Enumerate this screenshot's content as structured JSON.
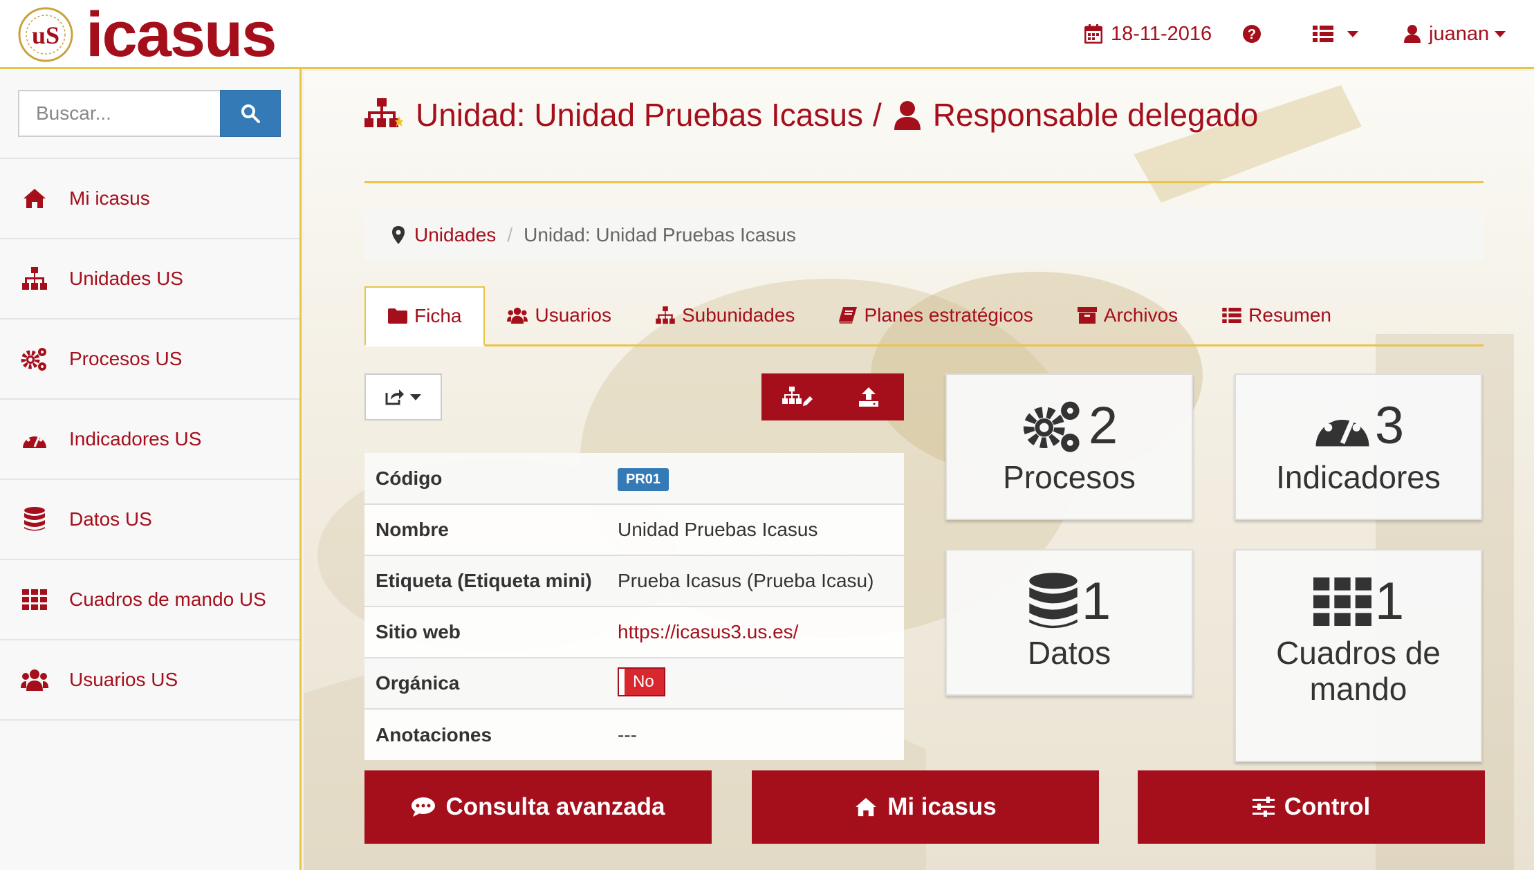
{
  "brand": {
    "name": "icasus"
  },
  "navbar": {
    "date": "18-11-2016",
    "user": "juanan",
    "icons": {
      "date": "calendar-icon",
      "help": "question-circle-icon",
      "menu": "list-icon",
      "user": "user-icon"
    }
  },
  "search": {
    "placeholder": "Buscar..."
  },
  "sidebar": {
    "items": [
      {
        "label": "Mi icasus",
        "icon": "home-icon"
      },
      {
        "label": "Unidades US",
        "icon": "sitemap-icon"
      },
      {
        "label": "Procesos US",
        "icon": "cogs-icon"
      },
      {
        "label": "Indicadores US",
        "icon": "dashboard-icon"
      },
      {
        "label": "Datos US",
        "icon": "database-icon"
      },
      {
        "label": "Cuadros de mando US",
        "icon": "th-icon"
      },
      {
        "label": "Usuarios US",
        "icon": "users-icon"
      }
    ]
  },
  "page": {
    "title_unit": "Unidad: Unidad Pruebas Icasus",
    "title_sep": "/",
    "title_role": "Responsable delegado"
  },
  "breadcrumb": {
    "link": "Unidades",
    "separator": "/",
    "current": "Unidad: Unidad Pruebas Icasus"
  },
  "tabs": [
    {
      "label": "Ficha",
      "icon": "folder-icon",
      "active": true
    },
    {
      "label": "Usuarios",
      "icon": "users-icon",
      "active": false
    },
    {
      "label": "Subunidades",
      "icon": "sitemap-icon",
      "active": false
    },
    {
      "label": "Planes estratégicos",
      "icon": "book-icon",
      "active": false
    },
    {
      "label": "Archivos",
      "icon": "archive-icon",
      "active": false
    },
    {
      "label": "Resumen",
      "icon": "list-icon",
      "active": false
    }
  ],
  "ficha": {
    "rows": [
      {
        "label": "Código",
        "value": "PR01"
      },
      {
        "label": "Nombre",
        "value": "Unidad Pruebas Icasus"
      },
      {
        "label": "Etiqueta (Etiqueta mini)",
        "value": "Prueba Icasus (Prueba Icasu)"
      },
      {
        "label": "Sitio web",
        "value": "https://icasus3.us.es/"
      },
      {
        "label": "Orgánica",
        "value": "No"
      },
      {
        "label": "Anotaciones",
        "value": "---"
      }
    ]
  },
  "stats": {
    "procesos": {
      "count": "2",
      "label": "Procesos"
    },
    "indicadores": {
      "count": "3",
      "label": "Indicadores"
    },
    "datos": {
      "count": "1",
      "label": "Datos"
    },
    "cuadros": {
      "count": "1",
      "label": "Cuadros de mando"
    }
  },
  "buttons": {
    "consulta": "Consulta avanzada",
    "miicasus": "Mi icasus",
    "control": "Control"
  },
  "colors": {
    "accent": "#a50f1c",
    "gold": "#e8c447",
    "primary_blue": "#337ab7"
  }
}
